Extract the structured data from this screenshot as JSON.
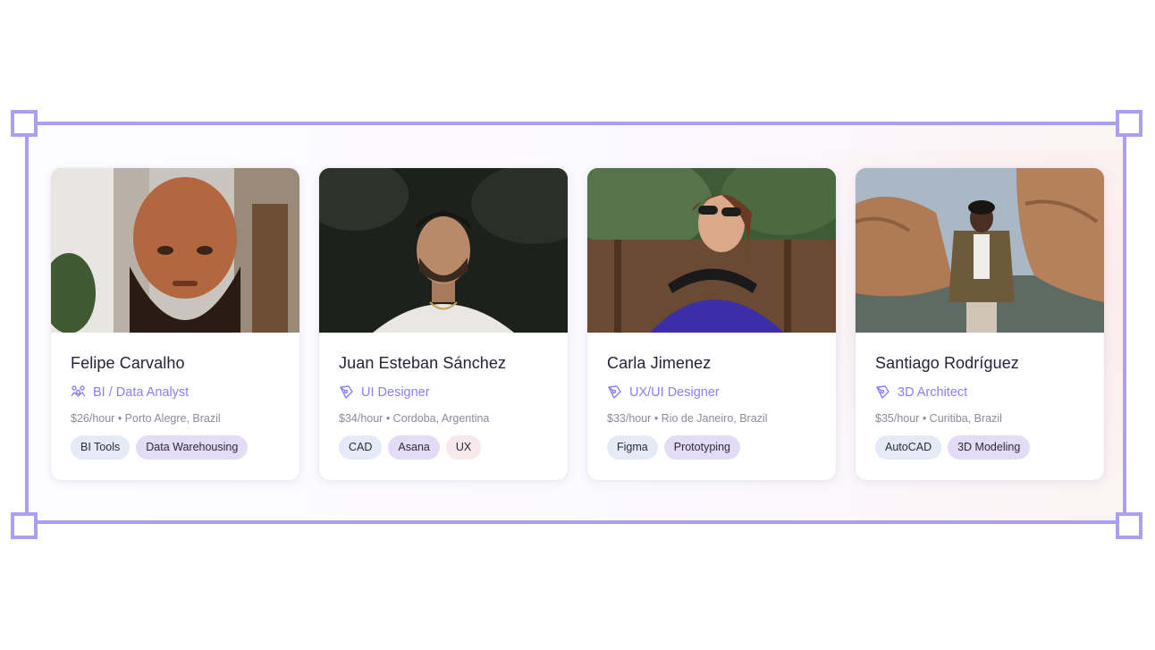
{
  "colors": {
    "accent": "#ab9ef3",
    "role_text": "#8a7ff0",
    "tag_blue": "#e4ebf7",
    "tag_purple": "#e4dcf6",
    "tag_pink": "#f7e8ec"
  },
  "profiles": [
    {
      "name": "Felipe Carvalho",
      "role": "BI / Data Analyst",
      "role_icon": "team-analytics-icon",
      "meta": "$26/hour • Porto Alegre, Brazil",
      "tags": [
        "BI Tools",
        "Data Warehousing"
      ]
    },
    {
      "name": "Juan Esteban Sánchez",
      "role": "UI Designer",
      "role_icon": "pen-tool-icon",
      "meta": "$34/hour • Cordoba, Argentina",
      "tags": [
        "CAD",
        "Asana",
        "UX"
      ]
    },
    {
      "name": "Carla Jimenez",
      "role": "UX/UI Designer",
      "role_icon": "pen-tool-icon",
      "meta": "$33/hour • Rio de Janeiro, Brazil",
      "tags": [
        "Figma",
        "Prototyping"
      ]
    },
    {
      "name": "Santiago Rodríguez",
      "role": "3D Architect",
      "role_icon": "pen-tool-icon",
      "meta": "$35/hour • Curitiba, Brazil",
      "tags": [
        "AutoCAD",
        "3D Modeling"
      ]
    }
  ]
}
